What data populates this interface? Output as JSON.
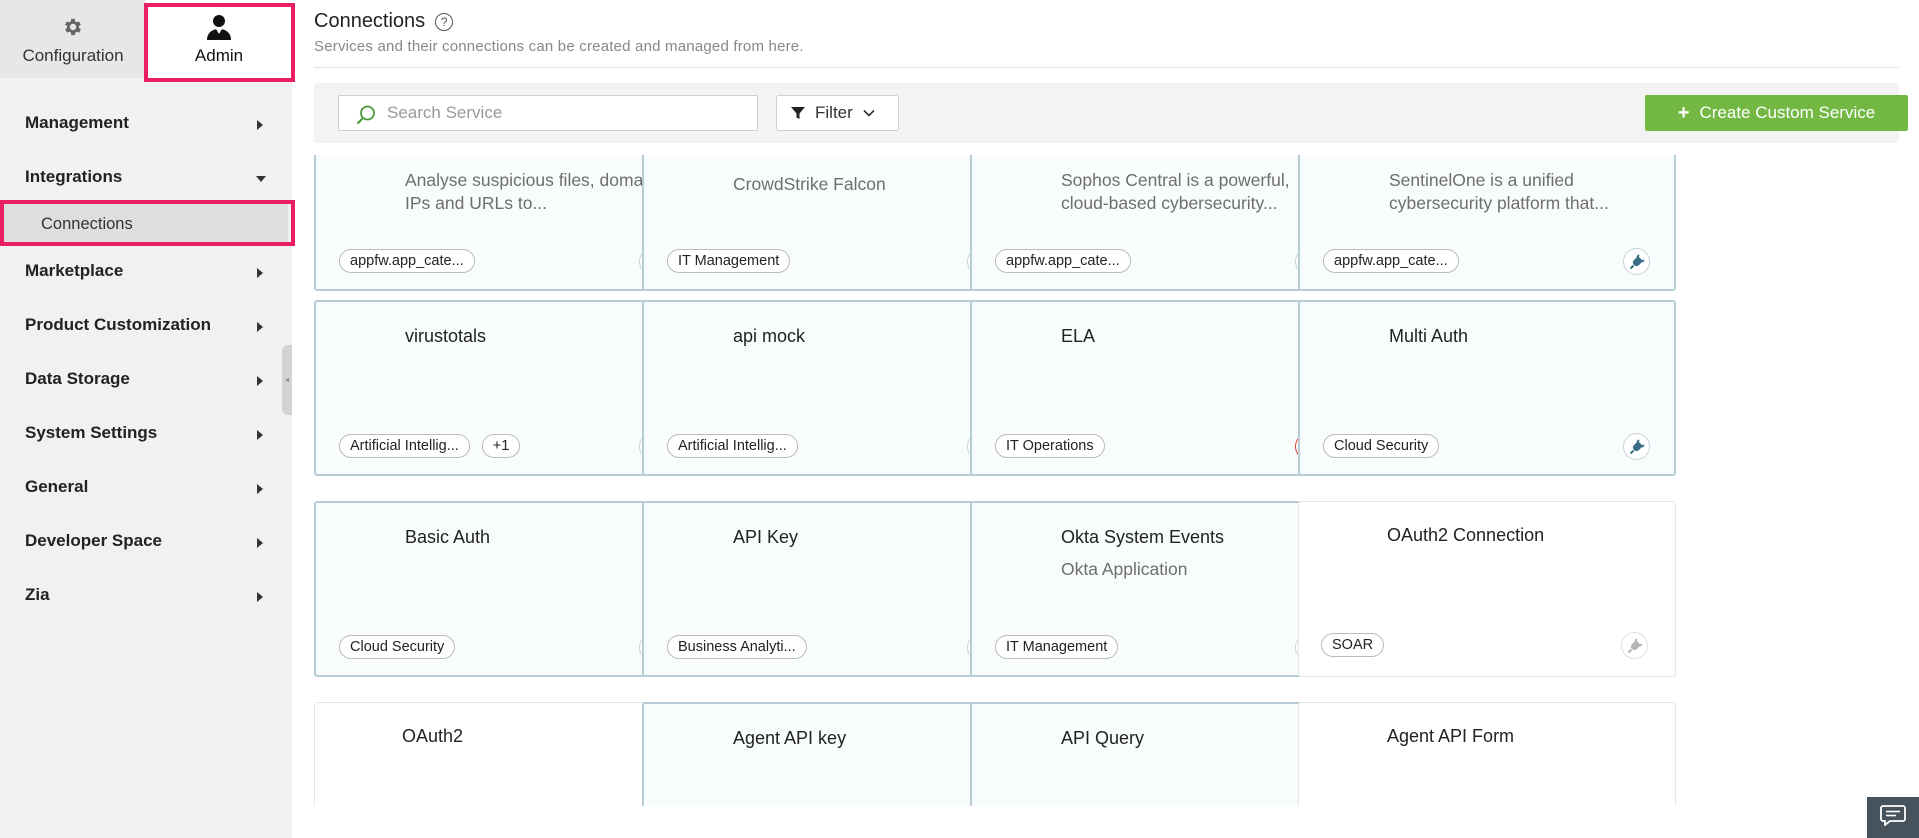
{
  "mode_tabs": {
    "configuration": "Configuration",
    "admin": "Admin"
  },
  "sidebar": {
    "items": [
      {
        "label": "Management",
        "state": "collapsed"
      },
      {
        "label": "Integrations",
        "state": "expanded"
      },
      {
        "label": "Marketplace",
        "state": "collapsed"
      },
      {
        "label": "Product Customization",
        "state": "collapsed"
      },
      {
        "label": "Data Storage",
        "state": "collapsed"
      },
      {
        "label": "System Settings",
        "state": "collapsed"
      },
      {
        "label": "General",
        "state": "collapsed"
      },
      {
        "label": "Developer Space",
        "state": "collapsed"
      },
      {
        "label": "Zia",
        "state": "collapsed"
      }
    ],
    "sub_item": "Connections"
  },
  "page": {
    "title": "Connections",
    "subtitle": "Services and their connections can be created and managed from here."
  },
  "toolbar": {
    "search_placeholder": "Search Service",
    "filter_label": "Filter",
    "create_label": "Create Custom Service"
  },
  "colors": {
    "accent_green": "#72b843",
    "highlight_pink": "#e91e63",
    "plug_icon": "#3b6f87",
    "alert_red": "#e53935"
  },
  "cards": [
    {
      "title": "",
      "desc": "Analyse suspicious files, domains, IPs and URLs to...",
      "tags": [
        "appfw.app_cate..."
      ],
      "plug": "active"
    },
    {
      "title": "",
      "desc": "CrowdStrike Falcon",
      "tags": [
        "IT Management"
      ],
      "plug": "active"
    },
    {
      "title": "",
      "desc": "Sophos Central is a powerful, cloud-based cybersecurity...",
      "tags": [
        "appfw.app_cate..."
      ],
      "plug": "active"
    },
    {
      "title": "",
      "desc": "SentinelOne is a unified cybersecurity platform that...",
      "tags": [
        "appfw.app_cate..."
      ],
      "plug": "active"
    },
    {
      "title": "virustotals",
      "desc": "",
      "tags": [
        "Artificial Intellig...",
        "+1"
      ],
      "plug": "active"
    },
    {
      "title": "api mock",
      "desc": "",
      "tags": [
        "Artificial Intellig..."
      ],
      "plug": "active"
    },
    {
      "title": "ELA",
      "desc": "",
      "tags": [
        "IT Operations"
      ],
      "plug": "alert"
    },
    {
      "title": "Multi Auth",
      "desc": "",
      "tags": [
        "Cloud Security"
      ],
      "plug": "active"
    },
    {
      "title": "Basic Auth",
      "desc": "",
      "tags": [
        "Cloud Security"
      ],
      "plug": "active"
    },
    {
      "title": "API Key",
      "desc": "",
      "tags": [
        "Business Analyti..."
      ],
      "plug": "active"
    },
    {
      "title": "Okta System Events",
      "desc": "Okta Application",
      "tags": [
        "IT Management"
      ],
      "plug": "active"
    },
    {
      "title": "OAuth2 Connection",
      "desc": "",
      "tags": [
        "SOAR"
      ],
      "plug": "inactive"
    },
    {
      "title": "OAuth2",
      "desc": "",
      "tags": [],
      "plug": "none"
    },
    {
      "title": "Agent API key",
      "desc": "",
      "tags": [],
      "plug": "none"
    },
    {
      "title": "API Query",
      "desc": "",
      "tags": [],
      "plug": "none"
    },
    {
      "title": "Agent API Form",
      "desc": "",
      "tags": [],
      "plug": "none"
    }
  ]
}
